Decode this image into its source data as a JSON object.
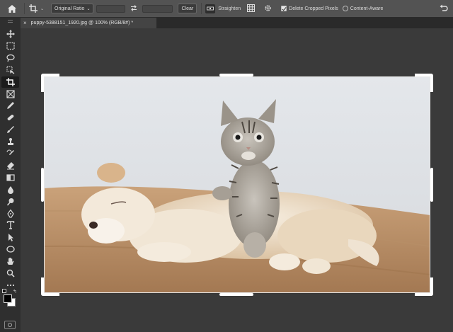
{
  "options_bar": {
    "home_icon": "home-icon",
    "crop_tool_icon": "crop-icon",
    "ratio_label": "Original Ratio",
    "swap_icon": "swap-icon",
    "clear_label": "Clear",
    "straighten_label": "Straighten",
    "grid_icon": "grid-overlay-icon",
    "settings_icon": "gear-icon",
    "delete_cropped_label": "Delete Cropped Pixels",
    "delete_cropped_checked": true,
    "content_aware_label": "Content-Aware",
    "content_aware_checked": false,
    "reset_icon": "undo-icon"
  },
  "document": {
    "tab_title": "puppy-5388151_1920.jpg @ 100% (RGB/8#) *",
    "close_symbol": "×"
  },
  "toolbar": {
    "tools": [
      "move-icon",
      "marquee-icon",
      "lasso-icon",
      "object-select-icon",
      "crop-icon",
      "frame-icon",
      "eyedropper-icon",
      "healing-icon",
      "brush-icon",
      "stamp-icon",
      "history-brush-icon",
      "eraser-icon",
      "gradient-icon",
      "blur-icon",
      "dodge-icon",
      "pen-icon",
      "type-icon",
      "path-select-icon",
      "shape-icon",
      "hand-icon",
      "zoom-icon",
      "more-icon"
    ],
    "active_tool": "crop-icon",
    "foreground_color": "#000000",
    "background_color": "#ffffff"
  },
  "colors": {
    "options_bg": "#535353",
    "toolbar_bg": "#2f2f2f",
    "canvas_bg": "#3a3a3a"
  }
}
